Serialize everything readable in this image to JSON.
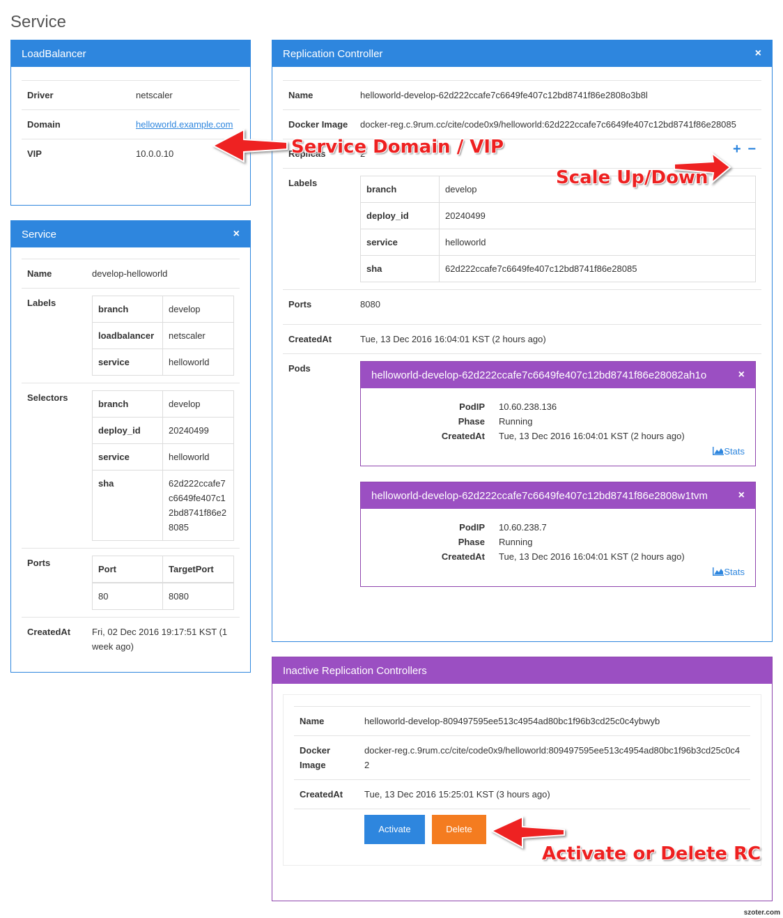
{
  "page": {
    "title": "Service"
  },
  "loadbalancer": {
    "header": "LoadBalancer",
    "rows": [
      {
        "key": "Driver",
        "value": "netscaler"
      },
      {
        "key": "Domain",
        "value": "helloworld.example.com"
      },
      {
        "key": "VIP",
        "value": "10.0.0.10"
      }
    ]
  },
  "service": {
    "header": "Service",
    "close_icon": "×",
    "name_key": "Name",
    "name_value": "develop-helloworld",
    "labels_key": "Labels",
    "labels": [
      {
        "key": "branch",
        "value": "develop"
      },
      {
        "key": "loadbalancer",
        "value": "netscaler"
      },
      {
        "key": "service",
        "value": "helloworld"
      }
    ],
    "selectors_key": "Selectors",
    "selectors": [
      {
        "key": "branch",
        "value": "develop"
      },
      {
        "key": "deploy_id",
        "value": "20240499"
      },
      {
        "key": "service",
        "value": "helloworld"
      },
      {
        "key": "sha",
        "value": "62d222ccafe7c6649fe407c12bd8741f86e28085"
      }
    ],
    "ports_key": "Ports",
    "ports_headers": [
      "Port",
      "TargetPort"
    ],
    "ports_row": [
      "80",
      "8080"
    ],
    "created_key": "CreatedAt",
    "created_value": "Fri, 02 Dec 2016 19:17:51 KST (1 week ago)"
  },
  "rc": {
    "header": "Replication Controller",
    "close_icon": "×",
    "name_key": "Name",
    "name_value": "helloworld-develop-62d222ccafe7c6649fe407c12bd8741f86e2808o3b8l",
    "image_key": "Docker Image",
    "image_value": "docker-reg.c.9rum.cc/cite/code0x9/helloworld:62d222ccafe7c6649fe407c12bd8741f86e28085",
    "replicas_key": "Replicas",
    "replicas_value": "2",
    "plus_icon": "+",
    "minus_icon": "−",
    "labels_key": "Labels",
    "labels": [
      {
        "key": "branch",
        "value": "develop"
      },
      {
        "key": "deploy_id",
        "value": "20240499"
      },
      {
        "key": "service",
        "value": "helloworld"
      },
      {
        "key": "sha",
        "value": "62d222ccafe7c6649fe407c12bd8741f86e28085"
      }
    ],
    "ports_key": "Ports",
    "ports_value": "8080",
    "created_key": "CreatedAt",
    "created_value": "Tue, 13 Dec 2016 16:04:01 KST (2 hours ago)",
    "pods_key": "Pods",
    "pods": [
      {
        "name": "helloworld-develop-62d222ccafe7c6649fe407c12bd8741f86e28082ah1o",
        "podip_key": "PodIP",
        "podip": "10.60.238.136",
        "phase_key": "Phase",
        "phase": "Running",
        "created_key": "CreatedAt",
        "created": "Tue, 13 Dec 2016 16:04:01 KST (2 hours ago)",
        "stats": "Stats"
      },
      {
        "name": "helloworld-develop-62d222ccafe7c6649fe407c12bd8741f86e2808w1tvm",
        "podip_key": "PodIP",
        "podip": "10.60.238.7",
        "phase_key": "Phase",
        "phase": "Running",
        "created_key": "CreatedAt",
        "created": "Tue, 13 Dec 2016 16:04:01 KST (2 hours ago)",
        "stats": "Stats"
      }
    ]
  },
  "inactive": {
    "header": "Inactive Replication Controllers",
    "name_key": "Name",
    "name_value": "helloworld-develop-809497595ee513c4954ad80bc1f96b3cd25c0c4ybwyb",
    "image_key": "Docker Image",
    "image_value": "docker-reg.c.9rum.cc/cite/code0x9/helloworld:809497595ee513c4954ad80bc1f96b3cd25c0c42",
    "created_key": "CreatedAt",
    "created_value": "Tue, 13 Dec 2016 15:25:01 KST (3 hours ago)",
    "activate_label": "Activate",
    "delete_label": "Delete"
  },
  "annotations": {
    "domain_vip": "Service Domain / VIP",
    "scale": "Scale Up/Down",
    "activate_delete": "Activate or Delete RC",
    "arrow_color": "#ee2020"
  },
  "watermark": "szoter.com",
  "colors": {
    "blue": "#2e86de",
    "purple": "#9b4fc2",
    "orange": "#f47c20"
  }
}
